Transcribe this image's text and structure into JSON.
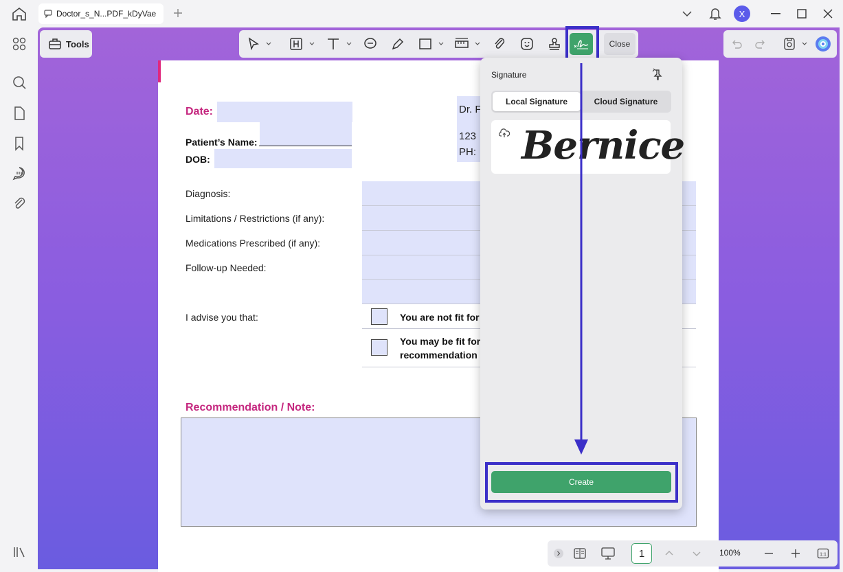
{
  "window": {
    "tab_title": "Doctor_s_N...PDF_kDyVae",
    "avatar_initial": "X"
  },
  "toolbar": {
    "tools_label": "Tools",
    "close_label": "Close",
    "active_tool": "signature"
  },
  "document": {
    "date_label": "Date:",
    "patient_name_label": "Patient’s Name:",
    "dob_label": "DOB:",
    "doctor_line": "Dr. F",
    "address_line": "123",
    "phone_line": "PH:",
    "diagnosis_label": "Diagnosis:",
    "limitations_label": "Limitations / Restrictions (if any):",
    "medications_label": "Medications Prescribed (if any):",
    "followup_label": "Follow-up Needed:",
    "advise_label": "I advise you that:",
    "option1": "You are not fit for",
    "option2_line1": "You may be fit for",
    "option2_line2": "recommendation",
    "recommendation_label": "Recommendation / Note:"
  },
  "signature_panel": {
    "title": "Signature",
    "tab_local": "Local Signature",
    "tab_cloud": "Cloud Signature",
    "signature_name": "Bernice",
    "create_label": "Create"
  },
  "bottombar": {
    "page": "1",
    "zoom": "100%"
  },
  "colors": {
    "accent_green": "#3fa36b",
    "highlight_blue": "#3b2fc8",
    "form_field": "#dfe3fb",
    "heading_pink": "#c5277f"
  }
}
